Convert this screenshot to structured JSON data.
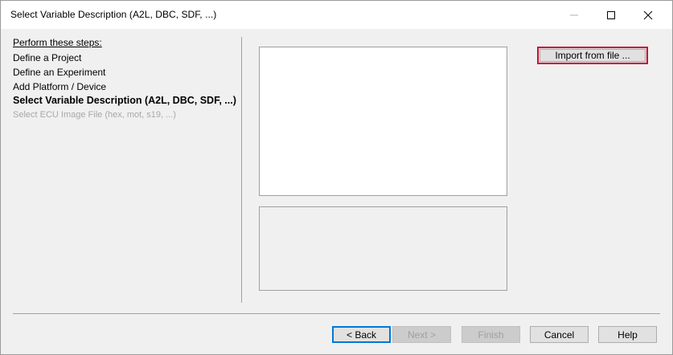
{
  "window": {
    "title": "Select Variable Description (A2L, DBC, SDF, ...)"
  },
  "steps": {
    "heading": "Perform these steps:",
    "items": [
      {
        "label": "Define a Project",
        "state": "done"
      },
      {
        "label": "Define an Experiment",
        "state": "done"
      },
      {
        "label": "Add Platform / Device",
        "state": "done"
      },
      {
        "label": "Select Variable Description (A2L, DBC, SDF, ...)",
        "state": "current"
      },
      {
        "label": "Select ECU Image File (hex, mot, s19, ...)",
        "state": "disabled"
      }
    ]
  },
  "actions": {
    "import_label": "Import from file ..."
  },
  "footer": {
    "back_label": "< Back",
    "next_label": "Next >",
    "finish_label": "Finish",
    "cancel_label": "Cancel",
    "help_label": "Help"
  },
  "colors": {
    "highlight_border": "#c8102e",
    "default_button_border": "#0078d7",
    "disabled_text": "#a8a8a8"
  },
  "icons": {
    "minimize": "minimize-icon",
    "maximize": "maximize-icon",
    "close": "close-icon"
  }
}
